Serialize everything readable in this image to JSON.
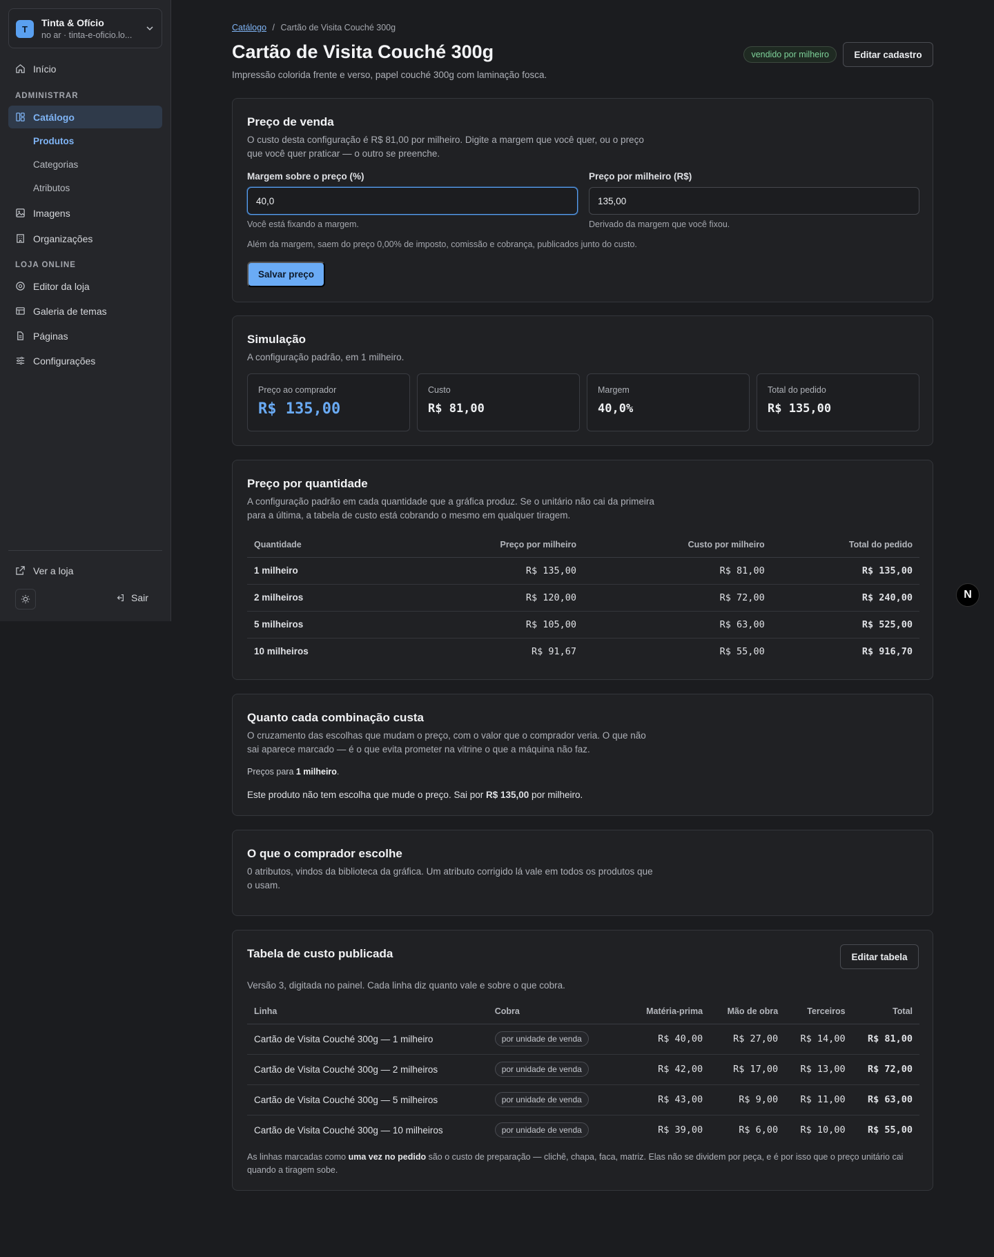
{
  "org": {
    "initial": "T",
    "name": "Tinta & Ofício",
    "subtitle": "no ar · tinta-e-oficio.lo..."
  },
  "nav": {
    "inicio": "Início",
    "section_admin": "ADMINISTRAR",
    "catalogo": "Catálogo",
    "produtos": "Produtos",
    "categorias": "Categorias",
    "atributos": "Atributos",
    "imagens": "Imagens",
    "organizacoes": "Organizações",
    "section_loja": "LOJA ONLINE",
    "editor": "Editor da loja",
    "galeria": "Galeria de temas",
    "paginas": "Páginas",
    "configuracoes": "Configurações",
    "ver_loja": "Ver a loja",
    "sair": "Sair"
  },
  "breadcrumb": {
    "parent": "Catálogo",
    "separator": "/",
    "current": "Cartão de Visita Couché 300g"
  },
  "page": {
    "title": "Cartão de Visita Couché 300g",
    "subtitle": "Impressão colorida frente e verso, papel couché 300g com laminação fosca.",
    "badge": "vendido por milheiro",
    "edit_button": "Editar cadastro"
  },
  "price": {
    "title": "Preço de venda",
    "description": "O custo desta configuração é R$ 81,00 por milheiro. Digite a margem que você quer, ou o preço que você quer praticar — o outro se preenche.",
    "margin_label": "Margem sobre o preço (%)",
    "margin_value": "40,0",
    "margin_hint": "Você está fixando a margem.",
    "price_label": "Preço por milheiro (R$)",
    "price_value": "135,00",
    "price_hint": "Derivado da margem que você fixou.",
    "note": "Além da margem, saem do preço 0,00% de imposto, comissão e cobrança, publicados junto do custo.",
    "save_button": "Salvar preço"
  },
  "simulation": {
    "title": "Simulação",
    "description": "A configuração padrão, em 1 milheiro.",
    "stats": [
      {
        "label": "Preço ao comprador",
        "value": "R$ 135,00"
      },
      {
        "label": "Custo",
        "value": "R$ 81,00"
      },
      {
        "label": "Margem",
        "value": "40,0%"
      },
      {
        "label": "Total do pedido",
        "value": "R$ 135,00"
      }
    ]
  },
  "quantity": {
    "title": "Preço por quantidade",
    "description": "A configuração padrão em cada quantidade que a gráfica produz. Se o unitário não cai da primeira para a última, a tabela de custo está cobrando o mesmo em qualquer tiragem.",
    "headers": [
      "Quantidade",
      "Preço por milheiro",
      "Custo por milheiro",
      "Total do pedido"
    ],
    "rows": [
      [
        "1 milheiro",
        "R$ 135,00",
        "R$ 81,00",
        "R$ 135,00"
      ],
      [
        "2 milheiros",
        "R$ 120,00",
        "R$ 72,00",
        "R$ 240,00"
      ],
      [
        "5 milheiros",
        "R$ 105,00",
        "R$ 63,00",
        "R$ 525,00"
      ],
      [
        "10 milheiros",
        "R$ 91,67",
        "R$ 55,00",
        "R$ 916,70"
      ]
    ]
  },
  "combos": {
    "title": "Quanto cada combinação custa",
    "description": "O cruzamento das escolhas que mudam o preço, com o valor que o comprador veria. O que não sai aparece marcado — é o que evita prometer na vitrine o que a máquina não faz.",
    "prices_for_prefix": "Preços para ",
    "prices_for_qty": "1 milheiro",
    "prices_for_suffix": ".",
    "no_choice_prefix": "Este produto não tem escolha que mude o preço. Sai por ",
    "no_choice_price": "R$ 135,00",
    "no_choice_suffix": " por milheiro."
  },
  "buyer": {
    "title": "O que o comprador escolhe",
    "description": "0 atributos, vindos da biblioteca da gráfica. Um atributo corrigido lá vale em todos os produtos que o usam."
  },
  "cost_table": {
    "title": "Tabela de custo publicada",
    "edit_button": "Editar tabela",
    "description": "Versão 3, digitada no painel. Cada linha diz quanto vale e sobre o que cobra.",
    "headers": [
      "Linha",
      "Cobra",
      "Matéria-prima",
      "Mão de obra",
      "Terceiros",
      "Total"
    ],
    "rows": [
      [
        "Cartão de Visita Couché 300g — 1 milheiro",
        "por unidade de venda",
        "R$ 40,00",
        "R$ 27,00",
        "R$ 14,00",
        "R$ 81,00"
      ],
      [
        "Cartão de Visita Couché 300g — 2 milheiros",
        "por unidade de venda",
        "R$ 42,00",
        "R$ 17,00",
        "R$ 13,00",
        "R$ 72,00"
      ],
      [
        "Cartão de Visita Couché 300g — 5 milheiros",
        "por unidade de venda",
        "R$ 43,00",
        "R$ 9,00",
        "R$ 11,00",
        "R$ 63,00"
      ],
      [
        "Cartão de Visita Couché 300g — 10 milheiros",
        "por unidade de venda",
        "R$ 39,00",
        "R$ 6,00",
        "R$ 10,00",
        "R$ 55,00"
      ]
    ],
    "footnote_prefix": "As linhas marcadas como ",
    "footnote_bold": "uma vez no pedido",
    "footnote_suffix": " são o custo de preparação — clichê, chapa, faca, matriz. Elas não se dividem por peça, e é por isso que o preço unitário cai quando a tiragem sobe."
  },
  "fab": {
    "letter": "N"
  }
}
